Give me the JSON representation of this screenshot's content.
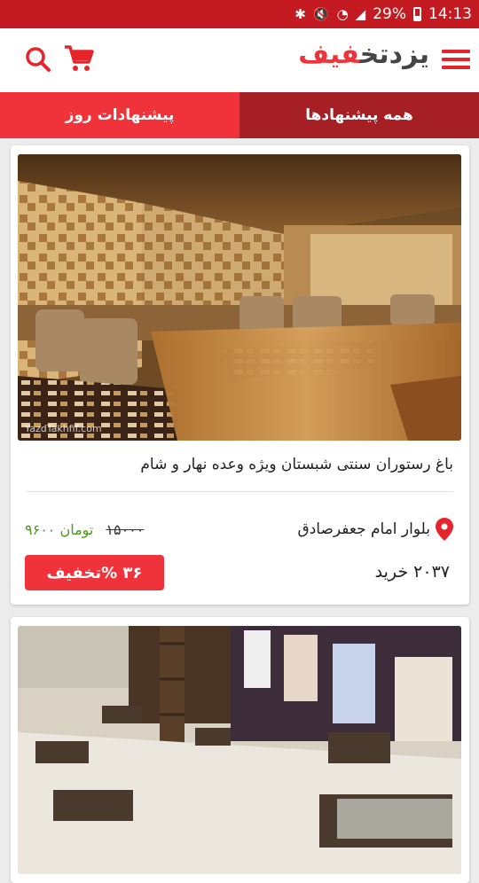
{
  "status_bar": {
    "battery": "29%",
    "time": "14:13",
    "icons": [
      "bluetooth-icon",
      "mute-icon",
      "wifi-icon",
      "signal-icon",
      "battery-icon"
    ]
  },
  "app_bar": {
    "logo_main": "یزدتخ",
    "logo_accent": "فیف",
    "icons": [
      "search-icon",
      "cart-icon",
      "menu-icon"
    ]
  },
  "tabs": [
    {
      "label": "پیشنهادات روز"
    },
    {
      "label": "همه پیشنهادها",
      "selected": true
    }
  ],
  "deals": [
    {
      "title": "باغ رستوران سنتی شبستان ویژه وعده نهار و شام",
      "location": "بلوار امام جعفرصادق",
      "old_price": "۱۵۰۰۰",
      "new_price": "۹۶۰۰ تومان",
      "discount": "۳۶ %تخفیف",
      "purchases": "۲۰۳۷ خرید",
      "image_watermark": "YazdTakhfif.com"
    },
    {
      "title": "",
      "image": "restaurant-interior-photo"
    }
  ],
  "colors": {
    "status_bar": "#c41a21",
    "accent": "#f0323b",
    "tab_selected": "#a51f24",
    "price_green": "#4f9a1d"
  }
}
